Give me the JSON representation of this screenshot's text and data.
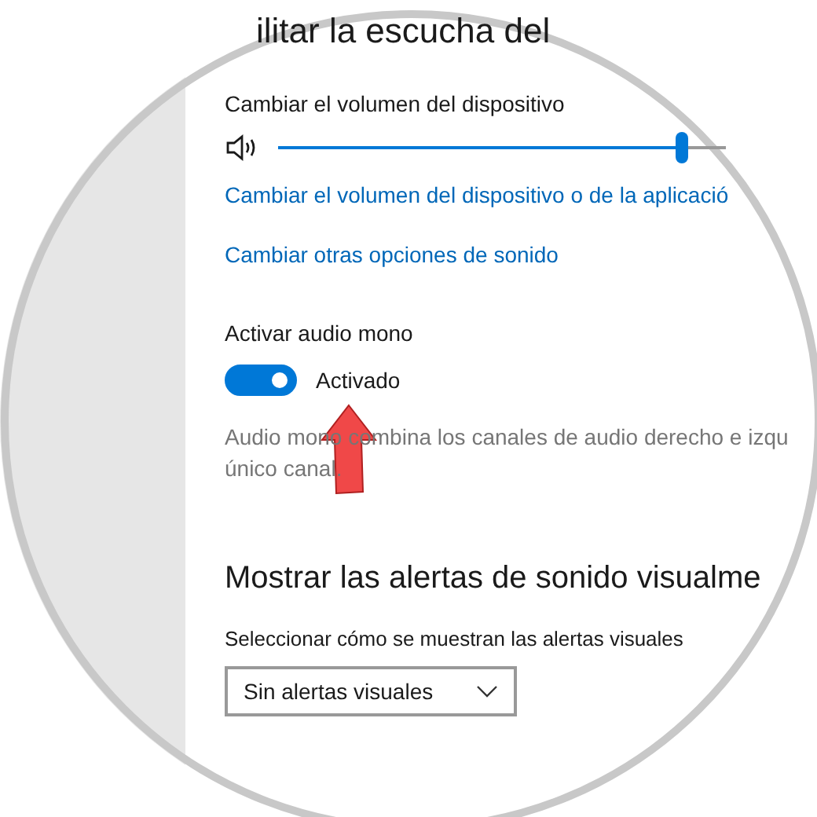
{
  "section_title": "ilitar la escucha del",
  "volume": {
    "label": "Cambiar el volumen del dispositivo",
    "level": 0.9
  },
  "links": [
    "Cambiar el volumen del dispositivo o de la aplicació",
    "Cambiar otras opciones de sonido"
  ],
  "mono": {
    "label": "Activar audio mono",
    "on": true,
    "state_text": "Activado",
    "description": [
      "Audio mono combina los canales de audio derecho e izqu",
      "único canal."
    ]
  },
  "alerts": {
    "title": "Mostrar las alertas de sonido visualme",
    "label": "Seleccionar cómo se muestran las alertas visuales",
    "value": "Sin alertas visuales"
  }
}
